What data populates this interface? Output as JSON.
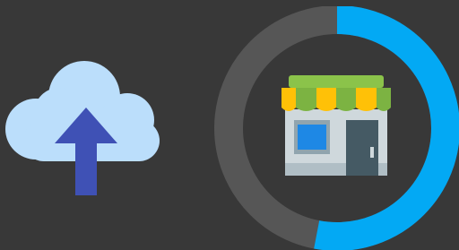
{
  "upload": {
    "icon": "cloud-upload-icon",
    "cloud_color": "#bbdefb",
    "arrow_color": "#3f51b5"
  },
  "progress": {
    "fraction": 0.53,
    "track_color": "#565656",
    "fill_color": "#03a9f4"
  },
  "store": {
    "icon": "storefront-icon",
    "awning_green": "#7cb342",
    "awning_yellow": "#ffc107",
    "wall_color": "#cfd8dc",
    "window_color": "#1e88e5",
    "door_color": "#455a64"
  }
}
